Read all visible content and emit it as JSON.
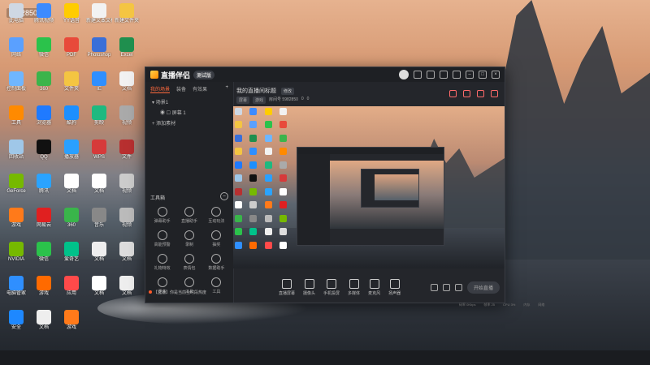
{
  "desktop": {
    "watermark": "5982850",
    "icons": [
      {
        "label": "此电脑",
        "color": "#cfd8e3"
      },
      {
        "label": "腾讯视频",
        "color": "#3d8bff"
      },
      {
        "label": "YY语音",
        "color": "#ffcc00"
      },
      {
        "label": "新建文本文档",
        "color": "#f2f2f2"
      },
      {
        "label": "新建文件夹",
        "color": "#f4c542"
      },
      {
        "label": "网络",
        "color": "#5aa0ff"
      },
      {
        "label": "微信",
        "color": "#2bc24b"
      },
      {
        "label": "PDF",
        "color": "#e84a3a"
      },
      {
        "label": "Photoshop",
        "color": "#3a6fd8"
      },
      {
        "label": "Excel",
        "color": "#1f8f4e"
      },
      {
        "label": "控制面板",
        "color": "#6fb6ff"
      },
      {
        "label": "360",
        "color": "#3cb44b"
      },
      {
        "label": "文件夹",
        "color": "#f4c542"
      },
      {
        "label": "IE",
        "color": "#2f8fff"
      },
      {
        "label": "文档",
        "color": "#f2f2f2"
      },
      {
        "label": "工具",
        "color": "#ff8a00"
      },
      {
        "label": "浏览器",
        "color": "#1f7aff"
      },
      {
        "label": "酷狗",
        "color": "#1d8fff"
      },
      {
        "label": "剪映",
        "color": "#1eb980"
      },
      {
        "label": "视频",
        "color": "#aaaaaa"
      },
      {
        "label": "回收站",
        "color": "#9fc7e8"
      },
      {
        "label": "QQ",
        "color": "#111111"
      },
      {
        "label": "播放器",
        "color": "#2aa0ff"
      },
      {
        "label": "WPS",
        "color": "#d63a3a"
      },
      {
        "label": "文件",
        "color": "#b83030"
      },
      {
        "label": "GeForce",
        "color": "#76b900"
      },
      {
        "label": "腾讯",
        "color": "#2aa3ff"
      },
      {
        "label": "文档",
        "color": "#ffffff"
      },
      {
        "label": "文档",
        "color": "#ffffff"
      },
      {
        "label": "视频",
        "color": "#cccccc"
      },
      {
        "label": "游戏",
        "color": "#ff7a1a"
      },
      {
        "label": "网易云",
        "color": "#e02020"
      },
      {
        "label": "360",
        "color": "#39b54a"
      },
      {
        "label": "音乐",
        "color": "#888888"
      },
      {
        "label": "视频",
        "color": "#bbbbbb"
      },
      {
        "label": "NVIDIA",
        "color": "#76b900"
      },
      {
        "label": "微信",
        "color": "#2bc24b"
      },
      {
        "label": "爱奇艺",
        "color": "#00c28a"
      },
      {
        "label": "文档",
        "color": "#eeeeee"
      },
      {
        "label": "文档",
        "color": "#dddddd"
      },
      {
        "label": "电脑管家",
        "color": "#2f8fff"
      },
      {
        "label": "游戏",
        "color": "#ff6a00"
      },
      {
        "label": "应用",
        "color": "#ff4a4a"
      },
      {
        "label": "文档",
        "color": "#ffffff"
      },
      {
        "label": "文档",
        "color": "#eeeeee"
      },
      {
        "label": "安全",
        "color": "#1e88ff"
      },
      {
        "label": "文档",
        "color": "#eeeeee"
      },
      {
        "label": "游戏",
        "color": "#ff7a1a"
      }
    ]
  },
  "app": {
    "title": "直播伴侣",
    "beta": "测试版",
    "left": {
      "tabs": [
        "我的场景",
        "装备",
        "有效果"
      ],
      "scene_root": "场景1",
      "scene_child": "屏幕 1",
      "add_scene": "添加素材",
      "tools_title": "工具箱",
      "tools": [
        "弹幕助手",
        "直播助手",
        "互动玩法",
        "高能预警",
        "录制",
        "抽奖",
        "礼物特效",
        "表情包",
        "数据助手",
        "更多",
        "工具",
        "工具"
      ],
      "notice": "【直播】你是当前全时段热度"
    },
    "main": {
      "room_title": "我的直播间标题",
      "edit": "修改",
      "meta_chip1": "屏幕",
      "meta_chip2": "游戏",
      "meta_id": "房间号 5982850",
      "meta_count1": "0",
      "meta_count2": "0",
      "controls": [
        "直播屏幕",
        "摄像头",
        "手机投屏",
        "多媒体",
        "麦克风",
        "扬声器"
      ],
      "start": "开始直播",
      "status": [
        "码率 0Kbps",
        "帧率 25",
        "CPU 3%",
        "内存",
        "网络"
      ]
    }
  }
}
